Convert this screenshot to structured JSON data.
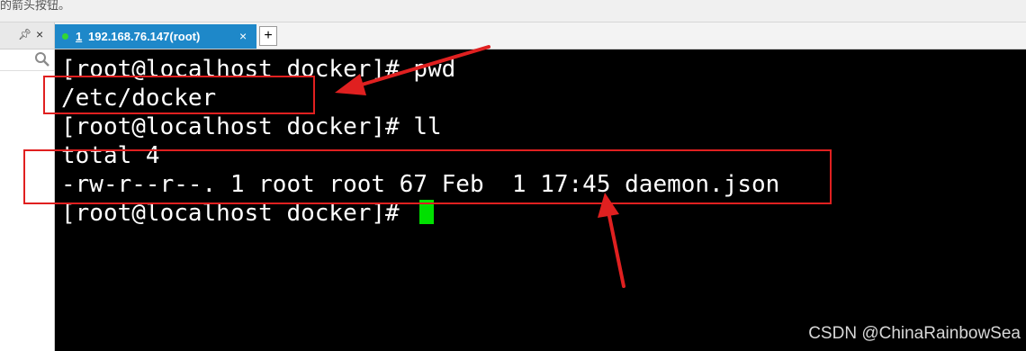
{
  "top_strip": {
    "text": "的箭头按钮。"
  },
  "left_panel": {
    "pin_icon": "pin-icon",
    "close_icon": "close-icon",
    "search_icon": "search-icon"
  },
  "tab_bar": {
    "active_tab": {
      "number": "1",
      "label": "192.168.76.147(root)",
      "close": "×",
      "status_color": "#33d633"
    },
    "new_tab": "+"
  },
  "terminal": {
    "lines": [
      "[root@localhost docker]# pwd",
      "/etc/docker",
      "[root@localhost docker]# ll",
      "total 4",
      "-rw-r--r--. 1 root root 67 Feb  1 17:45 daemon.json",
      "[root@localhost docker]# "
    ],
    "cursor_color": "#00e000"
  },
  "annotations": {
    "color": "#e02020"
  },
  "watermark": "CSDN @ChinaRainbowSea"
}
